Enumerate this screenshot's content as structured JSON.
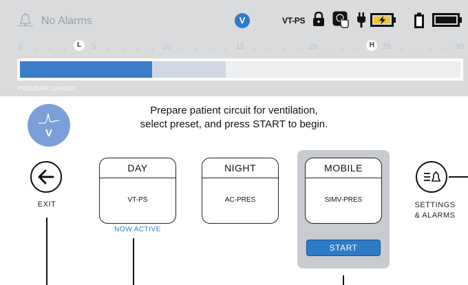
{
  "status": {
    "alarms_text": "No Alarms",
    "mode_badge": "V",
    "mode_text": "VT-PS",
    "icons": [
      "bell-icon",
      "lock-icon",
      "touch-lock-icon",
      "plug-icon",
      "battery-charging-icon",
      "battery-internal-icon",
      "battery-full-icon"
    ]
  },
  "pressure_scale": {
    "ticks": [
      "0",
      "5",
      "10",
      "15",
      "20",
      "25",
      "30"
    ],
    "low_marker": "L",
    "high_marker": "H",
    "label": "PRESSURE (cmH2O)",
    "current_value": 9,
    "peak_value": 14,
    "low_limit": 4,
    "high_limit": 24
  },
  "main": {
    "logo_letter": "V",
    "instructions_line1": "Prepare patient circuit for ventilation,",
    "instructions_line2": "select preset, and press START to begin.",
    "exit_label": "EXIT",
    "presets": [
      {
        "title": "DAY",
        "mode": "VT-PS",
        "status": "NOW ACTIVE"
      },
      {
        "title": "NIGHT",
        "mode": "AC-PRES"
      },
      {
        "title": "MOBILE",
        "mode": "SIMV-PRES"
      }
    ],
    "start_label": "START",
    "settings_label_line1": "SETTINGS",
    "settings_label_line2": "& ALARMS"
  },
  "colors": {
    "accent": "#2e7bc8",
    "header_bg": "#d9dbdd",
    "pressure_fill": "#3d7cc9",
    "selected_panel": "#c8cbd0"
  }
}
